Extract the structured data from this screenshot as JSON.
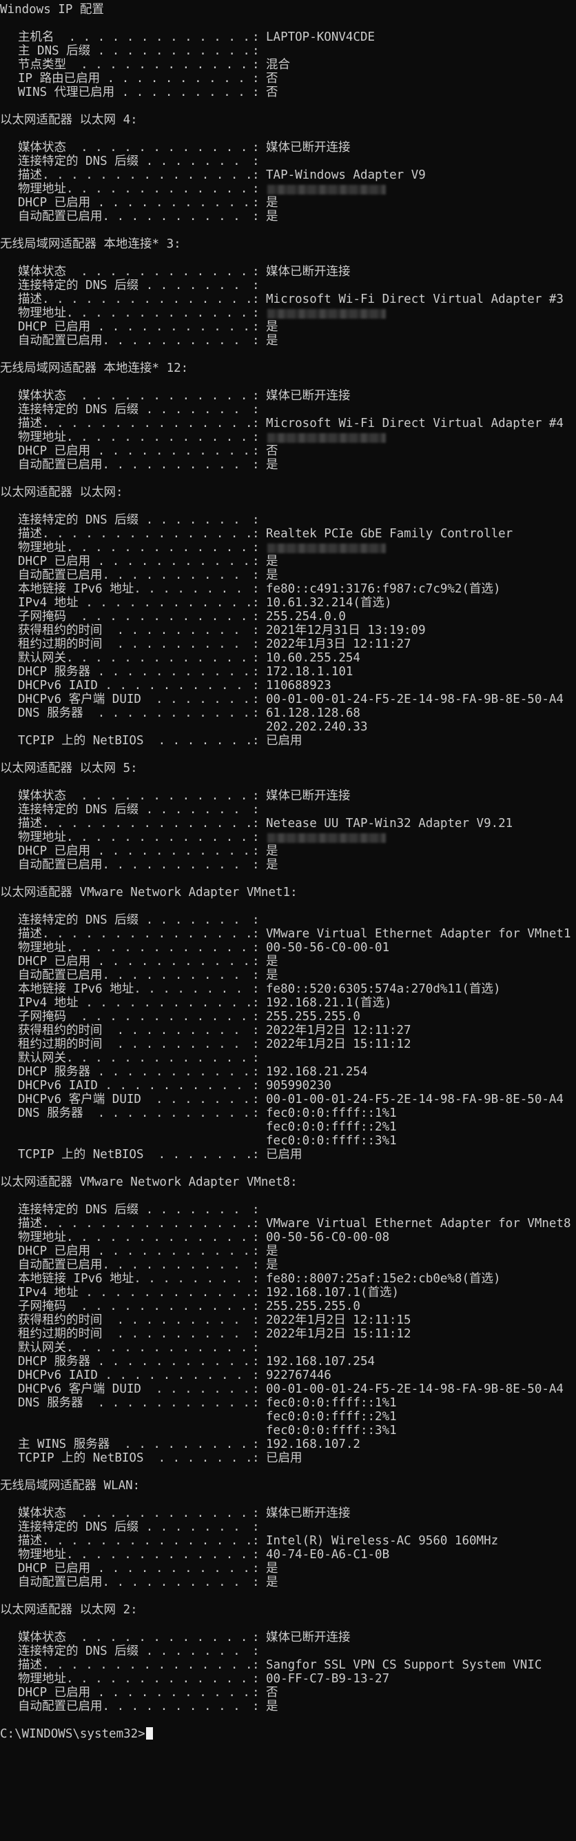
{
  "window": {
    "title": "Windows IP 配置",
    "prompt": "C:\\WINDOWS\\system32>"
  },
  "colors": {
    "background": "#0c0c0c",
    "text": "#cccccc",
    "cursor": "#f2f2f2"
  },
  "sections": [
    {
      "header": "",
      "rows": [
        {
          "label": "主机名  . . . . . . . . . . . . .",
          "value": "LAPTOP-KONV4CDE"
        },
        {
          "label": "主 DNS 后缀 . . . . . . . . . . .",
          "value": ""
        },
        {
          "label": "节点类型  . . . . . . . . . . . .",
          "value": "混合"
        },
        {
          "label": "IP 路由已启用 . . . . . . . . . .",
          "value": "否"
        },
        {
          "label": "WINS 代理已启用 . . . . . . . . .",
          "value": "否"
        }
      ]
    },
    {
      "header": "以太网适配器 以太网 4:",
      "rows": [
        {
          "label": "媒体状态  . . . . . . . . . . . .",
          "value": "媒体已断开连接"
        },
        {
          "label": "连接特定的 DNS 后缀 . . . . . . .",
          "value": ""
        },
        {
          "label": "描述. . . . . . . . . . . . . . .",
          "value": "TAP-Windows Adapter V9"
        },
        {
          "label": "物理地址. . . . . . . . . . . . .",
          "value": "",
          "blurred": true
        },
        {
          "label": "DHCP 已启用 . . . . . . . . . . .",
          "value": "是"
        },
        {
          "label": "自动配置已启用. . . . . . . . . .",
          "value": "是"
        }
      ]
    },
    {
      "header": "无线局域网适配器 本地连接* 3:",
      "rows": [
        {
          "label": "媒体状态  . . . . . . . . . . . .",
          "value": "媒体已断开连接"
        },
        {
          "label": "连接特定的 DNS 后缀 . . . . . . .",
          "value": ""
        },
        {
          "label": "描述. . . . . . . . . . . . . . .",
          "value": "Microsoft Wi-Fi Direct Virtual Adapter #3"
        },
        {
          "label": "物理地址. . . . . . . . . . . . .",
          "value": "",
          "blurred": true
        },
        {
          "label": "DHCP 已启用 . . . . . . . . . . .",
          "value": "是"
        },
        {
          "label": "自动配置已启用. . . . . . . . . .",
          "value": "是"
        }
      ]
    },
    {
      "header": "无线局域网适配器 本地连接* 12:",
      "rows": [
        {
          "label": "媒体状态  . . . . . . . . . . . .",
          "value": "媒体已断开连接"
        },
        {
          "label": "连接特定的 DNS 后缀 . . . . . . .",
          "value": ""
        },
        {
          "label": "描述. . . . . . . . . . . . . . .",
          "value": "Microsoft Wi-Fi Direct Virtual Adapter #4"
        },
        {
          "label": "物理地址. . . . . . . . . . . . .",
          "value": "",
          "blurred": true
        },
        {
          "label": "DHCP 已启用 . . . . . . . . . . .",
          "value": "否"
        },
        {
          "label": "自动配置已启用. . . . . . . . . .",
          "value": "是"
        }
      ]
    },
    {
      "header": "以太网适配器 以太网:",
      "rows": [
        {
          "label": "连接特定的 DNS 后缀 . . . . . . .",
          "value": ""
        },
        {
          "label": "描述. . . . . . . . . . . . . . .",
          "value": "Realtek PCIe GbE Family Controller"
        },
        {
          "label": "物理地址. . . . . . . . . . . . .",
          "value": "",
          "blurred": true
        },
        {
          "label": "DHCP 已启用 . . . . . . . . . . .",
          "value": "是"
        },
        {
          "label": "自动配置已启用. . . . . . . . . .",
          "value": "是"
        },
        {
          "label": "本地链接 IPv6 地址. . . . . . . .",
          "value": "fe80::c491:3176:f987:c7c9%2(首选)"
        },
        {
          "label": "IPv4 地址 . . . . . . . . . . . .",
          "value": "10.61.32.214(首选)"
        },
        {
          "label": "子网掩码  . . . . . . . . . . . .",
          "value": "255.254.0.0"
        },
        {
          "label": "获得租约的时间  . . . . . . . . .",
          "value": "2021年12月31日 13:19:09"
        },
        {
          "label": "租约过期的时间  . . . . . . . . .",
          "value": "2022年1月3日 12:11:27"
        },
        {
          "label": "默认网关. . . . . . . . . . . . .",
          "value": "10.60.255.254"
        },
        {
          "label": "DHCP 服务器 . . . . . . . . . . .",
          "value": "172.18.1.101"
        },
        {
          "label": "DHCPv6 IAID . . . . . . . . . . .",
          "value": "110688923"
        },
        {
          "label": "DHCPv6 客户端 DUID  . . . . . . .",
          "value": "00-01-00-01-24-F5-2E-14-98-FA-9B-8E-50-A4"
        },
        {
          "label": "DNS 服务器  . . . . . . . . . . .",
          "value": "61.128.128.68"
        },
        {
          "label": "",
          "sep": "",
          "value": "202.202.240.33"
        },
        {
          "label": "TCPIP 上的 NetBIOS  . . . . . . .",
          "value": "已启用"
        }
      ]
    },
    {
      "header": "以太网适配器 以太网 5:",
      "rows": [
        {
          "label": "媒体状态  . . . . . . . . . . . .",
          "value": "媒体已断开连接"
        },
        {
          "label": "连接特定的 DNS 后缀 . . . . . . .",
          "value": ""
        },
        {
          "label": "描述. . . . . . . . . . . . . . .",
          "value": "Netease UU TAP-Win32 Adapter V9.21"
        },
        {
          "label": "物理地址. . . . . . . . . . . . .",
          "value": "",
          "blurred": true
        },
        {
          "label": "DHCP 已启用 . . . . . . . . . . .",
          "value": "是"
        },
        {
          "label": "自动配置已启用. . . . . . . . . .",
          "value": "是"
        }
      ]
    },
    {
      "header": "以太网适配器 VMware Network Adapter VMnet1:",
      "rows": [
        {
          "label": "连接特定的 DNS 后缀 . . . . . . .",
          "value": ""
        },
        {
          "label": "描述. . . . . . . . . . . . . . .",
          "value": "VMware Virtual Ethernet Adapter for VMnet1"
        },
        {
          "label": "物理地址. . . . . . . . . . . . .",
          "value": "00-50-56-C0-00-01"
        },
        {
          "label": "DHCP 已启用 . . . . . . . . . . .",
          "value": "是"
        },
        {
          "label": "自动配置已启用. . . . . . . . . .",
          "value": "是"
        },
        {
          "label": "本地链接 IPv6 地址. . . . . . . .",
          "value": "fe80::520:6305:574a:270d%11(首选)"
        },
        {
          "label": "IPv4 地址 . . . . . . . . . . . .",
          "value": "192.168.21.1(首选)"
        },
        {
          "label": "子网掩码  . . . . . . . . . . . .",
          "value": "255.255.255.0"
        },
        {
          "label": "获得租约的时间  . . . . . . . . .",
          "value": "2022年1月2日 12:11:27"
        },
        {
          "label": "租约过期的时间  . . . . . . . . .",
          "value": "2022年1月2日 15:11:12"
        },
        {
          "label": "默认网关. . . . . . . . . . . . .",
          "value": ""
        },
        {
          "label": "DHCP 服务器 . . . . . . . . . . .",
          "value": "192.168.21.254"
        },
        {
          "label": "DHCPv6 IAID . . . . . . . . . . .",
          "value": "905990230"
        },
        {
          "label": "DHCPv6 客户端 DUID  . . . . . . .",
          "value": "00-01-00-01-24-F5-2E-14-98-FA-9B-8E-50-A4"
        },
        {
          "label": "DNS 服务器  . . . . . . . . . . .",
          "value": "fec0:0:0:ffff::1%1"
        },
        {
          "label": "",
          "sep": "",
          "value": "fec0:0:0:ffff::2%1"
        },
        {
          "label": "",
          "sep": "",
          "value": "fec0:0:0:ffff::3%1"
        },
        {
          "label": "TCPIP 上的 NetBIOS  . . . . . . .",
          "value": "已启用"
        }
      ]
    },
    {
      "header": "以太网适配器 VMware Network Adapter VMnet8:",
      "rows": [
        {
          "label": "连接特定的 DNS 后缀 . . . . . . .",
          "value": ""
        },
        {
          "label": "描述. . . . . . . . . . . . . . .",
          "value": "VMware Virtual Ethernet Adapter for VMnet8"
        },
        {
          "label": "物理地址. . . . . . . . . . . . .",
          "value": "00-50-56-C0-00-08"
        },
        {
          "label": "DHCP 已启用 . . . . . . . . . . .",
          "value": "是"
        },
        {
          "label": "自动配置已启用. . . . . . . . . .",
          "value": "是"
        },
        {
          "label": "本地链接 IPv6 地址. . . . . . . .",
          "value": "fe80::8007:25af:15e2:cb0e%8(首选)"
        },
        {
          "label": "IPv4 地址 . . . . . . . . . . . .",
          "value": "192.168.107.1(首选)"
        },
        {
          "label": "子网掩码  . . . . . . . . . . . .",
          "value": "255.255.255.0"
        },
        {
          "label": "获得租约的时间  . . . . . . . . .",
          "value": "2022年1月2日 12:11:15"
        },
        {
          "label": "租约过期的时间  . . . . . . . . .",
          "value": "2022年1月2日 15:11:12"
        },
        {
          "label": "默认网关. . . . . . . . . . . . .",
          "value": ""
        },
        {
          "label": "DHCP 服务器 . . . . . . . . . . .",
          "value": "192.168.107.254"
        },
        {
          "label": "DHCPv6 IAID . . . . . . . . . . .",
          "value": "922767446"
        },
        {
          "label": "DHCPv6 客户端 DUID  . . . . . . .",
          "value": "00-01-00-01-24-F5-2E-14-98-FA-9B-8E-50-A4"
        },
        {
          "label": "DNS 服务器  . . . . . . . . . . .",
          "value": "fec0:0:0:ffff::1%1"
        },
        {
          "label": "",
          "sep": "",
          "value": "fec0:0:0:ffff::2%1"
        },
        {
          "label": "",
          "sep": "",
          "value": "fec0:0:0:ffff::3%1"
        },
        {
          "label": "主 WINS 服务器  . . . . . . . . .",
          "value": "192.168.107.2"
        },
        {
          "label": "TCPIP 上的 NetBIOS  . . . . . . .",
          "value": "已启用"
        }
      ]
    },
    {
      "header": "无线局域网适配器 WLAN:",
      "rows": [
        {
          "label": "媒体状态  . . . . . . . . . . . .",
          "value": "媒体已断开连接"
        },
        {
          "label": "连接特定的 DNS 后缀 . . . . . . .",
          "value": ""
        },
        {
          "label": "描述. . . . . . . . . . . . . . .",
          "value": "Intel(R) Wireless-AC 9560 160MHz"
        },
        {
          "label": "物理地址. . . . . . . . . . . . .",
          "value": "40-74-E0-A6-C1-0B"
        },
        {
          "label": "DHCP 已启用 . . . . . . . . . . .",
          "value": "是"
        },
        {
          "label": "自动配置已启用. . . . . . . . . .",
          "value": "是"
        }
      ]
    },
    {
      "header": "以太网适配器 以太网 2:",
      "rows": [
        {
          "label": "媒体状态  . . . . . . . . . . . .",
          "value": "媒体已断开连接"
        },
        {
          "label": "连接特定的 DNS 后缀 . . . . . . .",
          "value": ""
        },
        {
          "label": "描述. . . . . . . . . . . . . . .",
          "value": "Sangfor SSL VPN CS Support System VNIC"
        },
        {
          "label": "物理地址. . . . . . . . . . . . .",
          "value": "00-FF-C7-B9-13-27"
        },
        {
          "label": "DHCP 已启用 . . . . . . . . . . .",
          "value": "否"
        },
        {
          "label": "自动配置已启用. . . . . . . . . .",
          "value": "是"
        }
      ]
    }
  ]
}
